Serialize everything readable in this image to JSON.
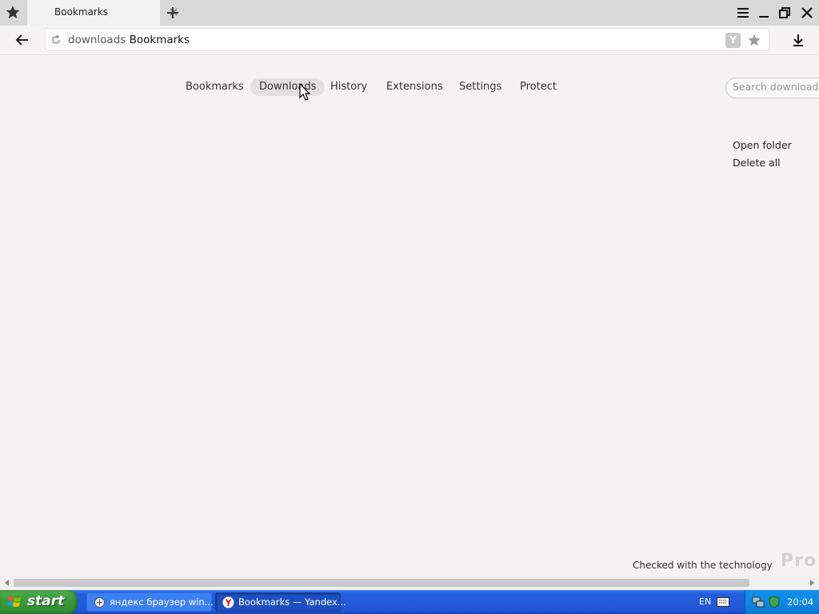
{
  "browser": {
    "tab_title": "Bookmarks",
    "address": {
      "host_text": "downloads",
      "page_text": "Bookmarks",
      "badge": "Y"
    }
  },
  "settings_nav": {
    "items": [
      "Bookmarks",
      "Downloads",
      "History",
      "Extensions",
      "Settings",
      "Protect"
    ],
    "active_index": 1,
    "search_placeholder": "Search downloads"
  },
  "downloads_actions": {
    "open_folder": "Open folder",
    "delete_all": "Delete all"
  },
  "footer": {
    "checked_text": "Checked with the technology",
    "logo_text": "Pro"
  },
  "taskbar": {
    "start_label": "start",
    "tasks": [
      {
        "label": "яндекс браузер win...",
        "active": false
      },
      {
        "label": "Bookmarks — Yandex...",
        "active": true
      }
    ],
    "language": "EN",
    "clock": "20:04"
  },
  "colors": {
    "page_bg": "#f5f4f2",
    "tabbar_bg": "#d8d8d8",
    "active_nav_bg": "#e2e1de",
    "taskbar_blue": "#245edc",
    "start_green": "#3c9a3c"
  }
}
